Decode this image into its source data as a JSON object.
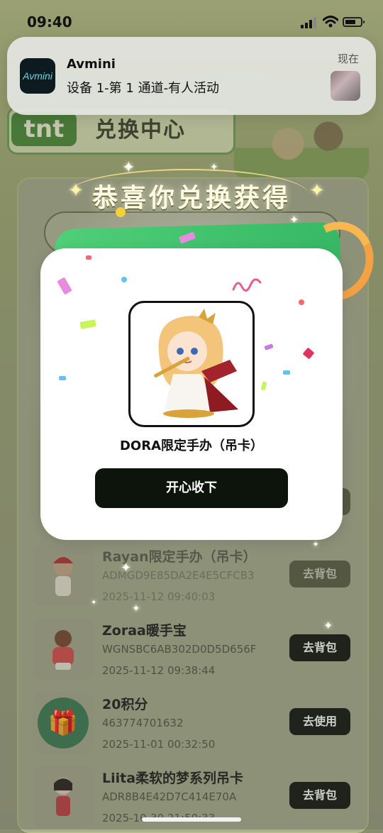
{
  "status_bar": {
    "time": "09:40"
  },
  "notification": {
    "app_icon_text": "Avmini",
    "app_name": "Avmini",
    "message": "设备 1-第 1 通道-有人活动",
    "time": "现在"
  },
  "background": {
    "logo": "tnt",
    "title": "兑换中心",
    "list": [
      {
        "name": "Rayan限定手办（吊卡）",
        "code": "ADMGD9E85DA2E4E5CFCB3",
        "time": "2025-11-12 09:40:03",
        "action": "去背包"
      },
      {
        "name": "Zoraa暖手宝",
        "code": "WGNSBC6AB302D0D5D656F",
        "time": "2025-11-12 09:38:44",
        "action": "去背包"
      },
      {
        "name": "20积分",
        "code": "463774701632",
        "time": "2025-11-01 00:32:50",
        "action": "去使用"
      },
      {
        "name": "Liita柔软的梦系列吊卡",
        "code": "ADR8B4E42D7C414E70A",
        "time": "2025-10-30 21:50:33",
        "action": "去背包"
      }
    ]
  },
  "modal": {
    "heading": "恭喜你兑换获得",
    "prize_name": "DORA限定手办（吊卡）",
    "confirm_label": "开心收下"
  },
  "icons": {
    "signal": "cellular-signal-icon",
    "wifi": "wifi-icon",
    "battery": "battery-icon",
    "gift": "gift-icon"
  },
  "colors": {
    "accent_green": "#37b864",
    "button_dark": "#0d140b",
    "orange_ring": "#f3a143"
  }
}
